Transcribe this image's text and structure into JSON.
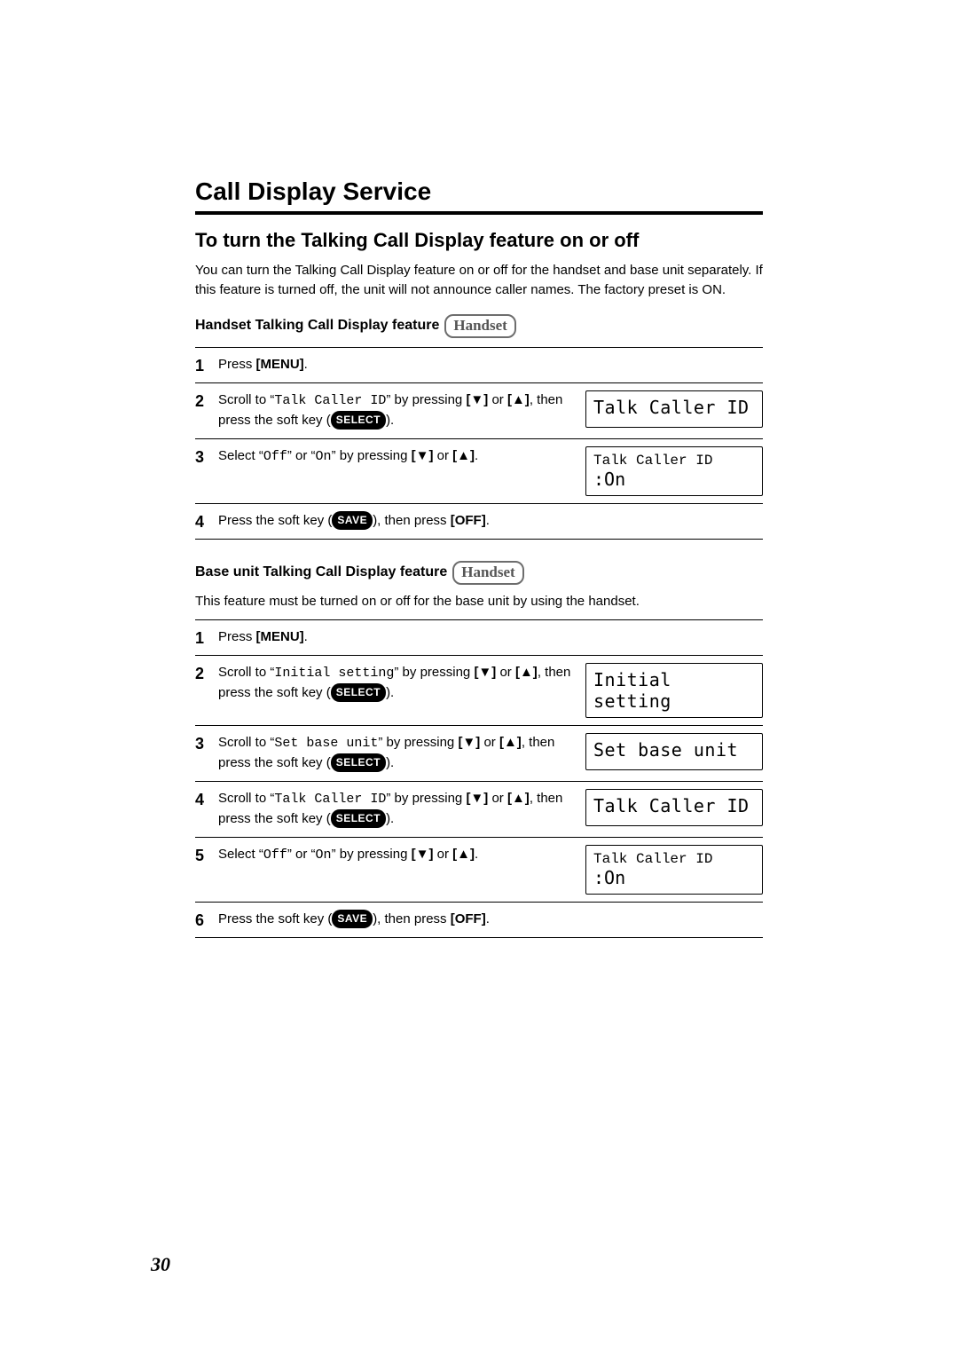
{
  "page": {
    "number": "30"
  },
  "section_title": "Call Display Service",
  "subsection_title": "To turn the Talking Call Display feature on or off",
  "intro_text": "You can turn the Talking Call Display feature on or off for the handset and base unit separately. If this feature is turned off, the unit will not announce caller names. The factory preset is ON.",
  "handset_heading": "Handset Talking Call Display feature",
  "handset_badge": "Handset",
  "base_heading": "Base unit Talking Call Display feature",
  "base_badge": "Handset",
  "base_note": "This feature must be turned on or off for the base unit by using the handset.",
  "pills": {
    "select": "SELECT",
    "save": "SAVE"
  },
  "keys": {
    "menu": "[MENU]",
    "off": "[OFF]",
    "down": "[▼]",
    "up": "[▲]"
  },
  "handset_steps": {
    "s1_a": "Press ",
    "s1_b": ".",
    "s2_a": "Scroll to “",
    "s2_code": "Talk Caller ID",
    "s2_b": "” by pressing ",
    "s2_c": " or ",
    "s2_d": ", then press the soft key (",
    "s2_e": ").",
    "s3_a": "Select “",
    "s3_off": "Off",
    "s3_mid": "” or “",
    "s3_on": "On",
    "s3_b": "” by pressing ",
    "s3_c": " or ",
    "s3_d": ".",
    "s4_a": "Press the soft key (",
    "s4_b": "), then press ",
    "s4_c": "."
  },
  "base_steps": {
    "s1_a": "Press ",
    "s1_b": ".",
    "s2_a": "Scroll to “",
    "s2_code": "Initial setting",
    "s2_b": "” by pressing ",
    "s2_c": " or ",
    "s2_d": ", then press the soft key (",
    "s2_e": ").",
    "s3_a": "Scroll to “",
    "s3_code": "Set base unit",
    "s3_b": "” by pressing ",
    "s3_c": " or ",
    "s3_d": ", then press the soft key (",
    "s3_e": ").",
    "s4_a": "Scroll to “",
    "s4_code": "Talk Caller ID",
    "s4_b": "” by pressing ",
    "s4_c": " or ",
    "s4_d": ", then press the soft key (",
    "s4_e": ").",
    "s5_a": "Select “",
    "s5_off": "Off",
    "s5_mid": "” or “",
    "s5_on": "On",
    "s5_b": "” by pressing ",
    "s5_c": " or ",
    "s5_d": ".",
    "s6_a": "Press the soft key (",
    "s6_b": "), then press ",
    "s6_c": "."
  },
  "displays": {
    "h2": "Talk Caller ID",
    "h3_l1": "Talk Caller ID",
    "h3_l2": ":On",
    "b2": "Initial setting",
    "b3": "Set base unit",
    "b4": "Talk Caller ID",
    "b5_l1": "Talk Caller ID",
    "b5_l2": ":On"
  }
}
